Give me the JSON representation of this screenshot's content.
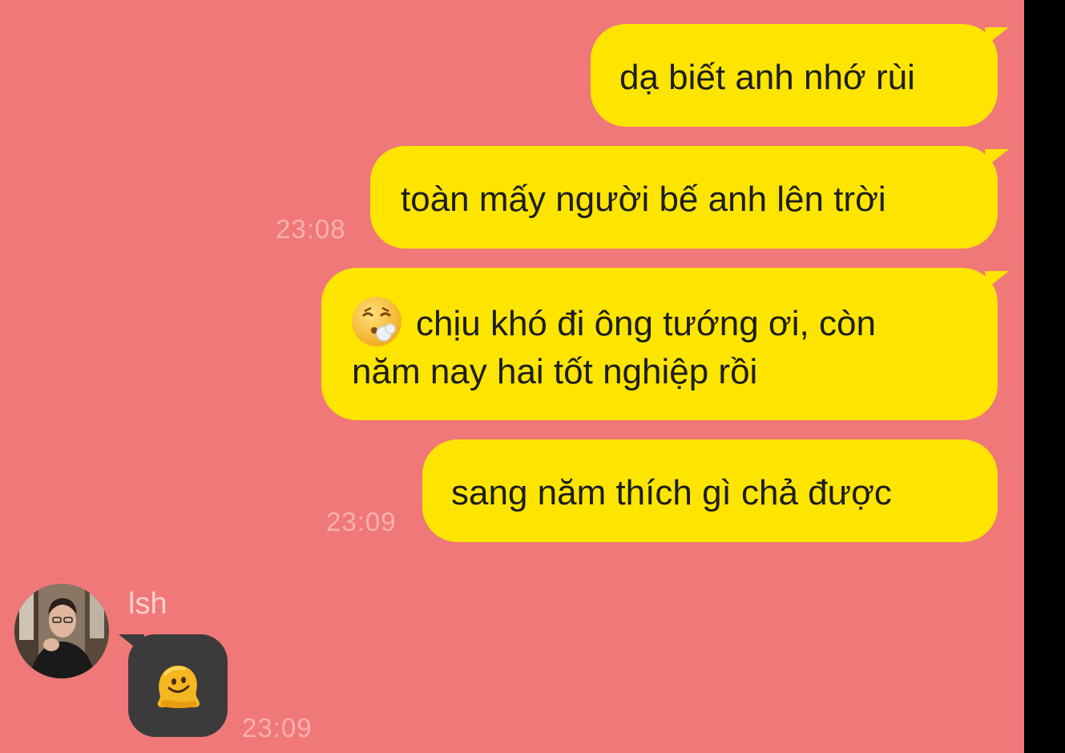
{
  "messages_out": [
    {
      "text": "dạ biết anh nhớ rùi"
    },
    {
      "text": "toàn mấy người bế anh lên trời",
      "time": "23:08"
    },
    {
      "line1": "chịu khó đi ông tướng ơi, còn",
      "line2": "năm nay hai tốt nghiệp rồi",
      "emoji": "face-exhaling-emoji"
    },
    {
      "text": "sang năm thích gì chả được",
      "time": "23:09"
    }
  ],
  "message_in": {
    "sender": "lsh",
    "emoji": "melting-face-emoji",
    "time": "23:09"
  },
  "colors": {
    "background": "#f07878",
    "outgoing_bubble": "#fde500",
    "incoming_bubble": "#3b3b3b",
    "timestamp": "#f6b0b0"
  }
}
